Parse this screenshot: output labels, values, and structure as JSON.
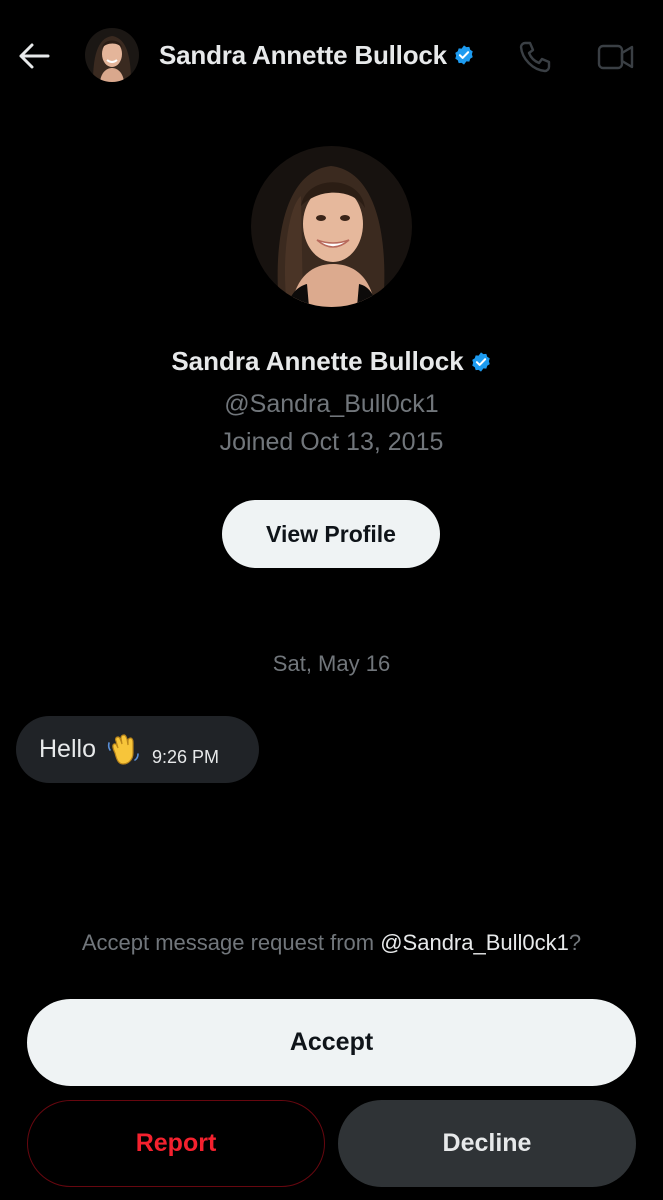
{
  "header": {
    "back_icon": "arrow-left-icon",
    "name": "Sandra Annette Bullock",
    "verified_icon": "verified-badge-icon",
    "call_icon": "phone-icon",
    "video_icon": "video-camera-icon"
  },
  "profile": {
    "name": "Sandra Annette Bullock",
    "handle": "@Sandra_Bull0ck1",
    "joined": "Joined Oct 13, 2015",
    "view_profile_label": "View Profile"
  },
  "conversation": {
    "date": "Sat, May 16",
    "messages": [
      {
        "text": "Hello",
        "emoji": "waving-hand",
        "time": "9:26 PM"
      }
    ]
  },
  "request": {
    "prefix": "Accept message request from ",
    "handle": "@Sandra_Bull0ck1",
    "suffix": "?",
    "accept_label": "Accept",
    "report_label": "Report",
    "decline_label": "Decline"
  },
  "colors": {
    "background": "#000000",
    "verified": "#1d9bf0",
    "secondary_text": "#71767b",
    "report": "#f4212e"
  }
}
